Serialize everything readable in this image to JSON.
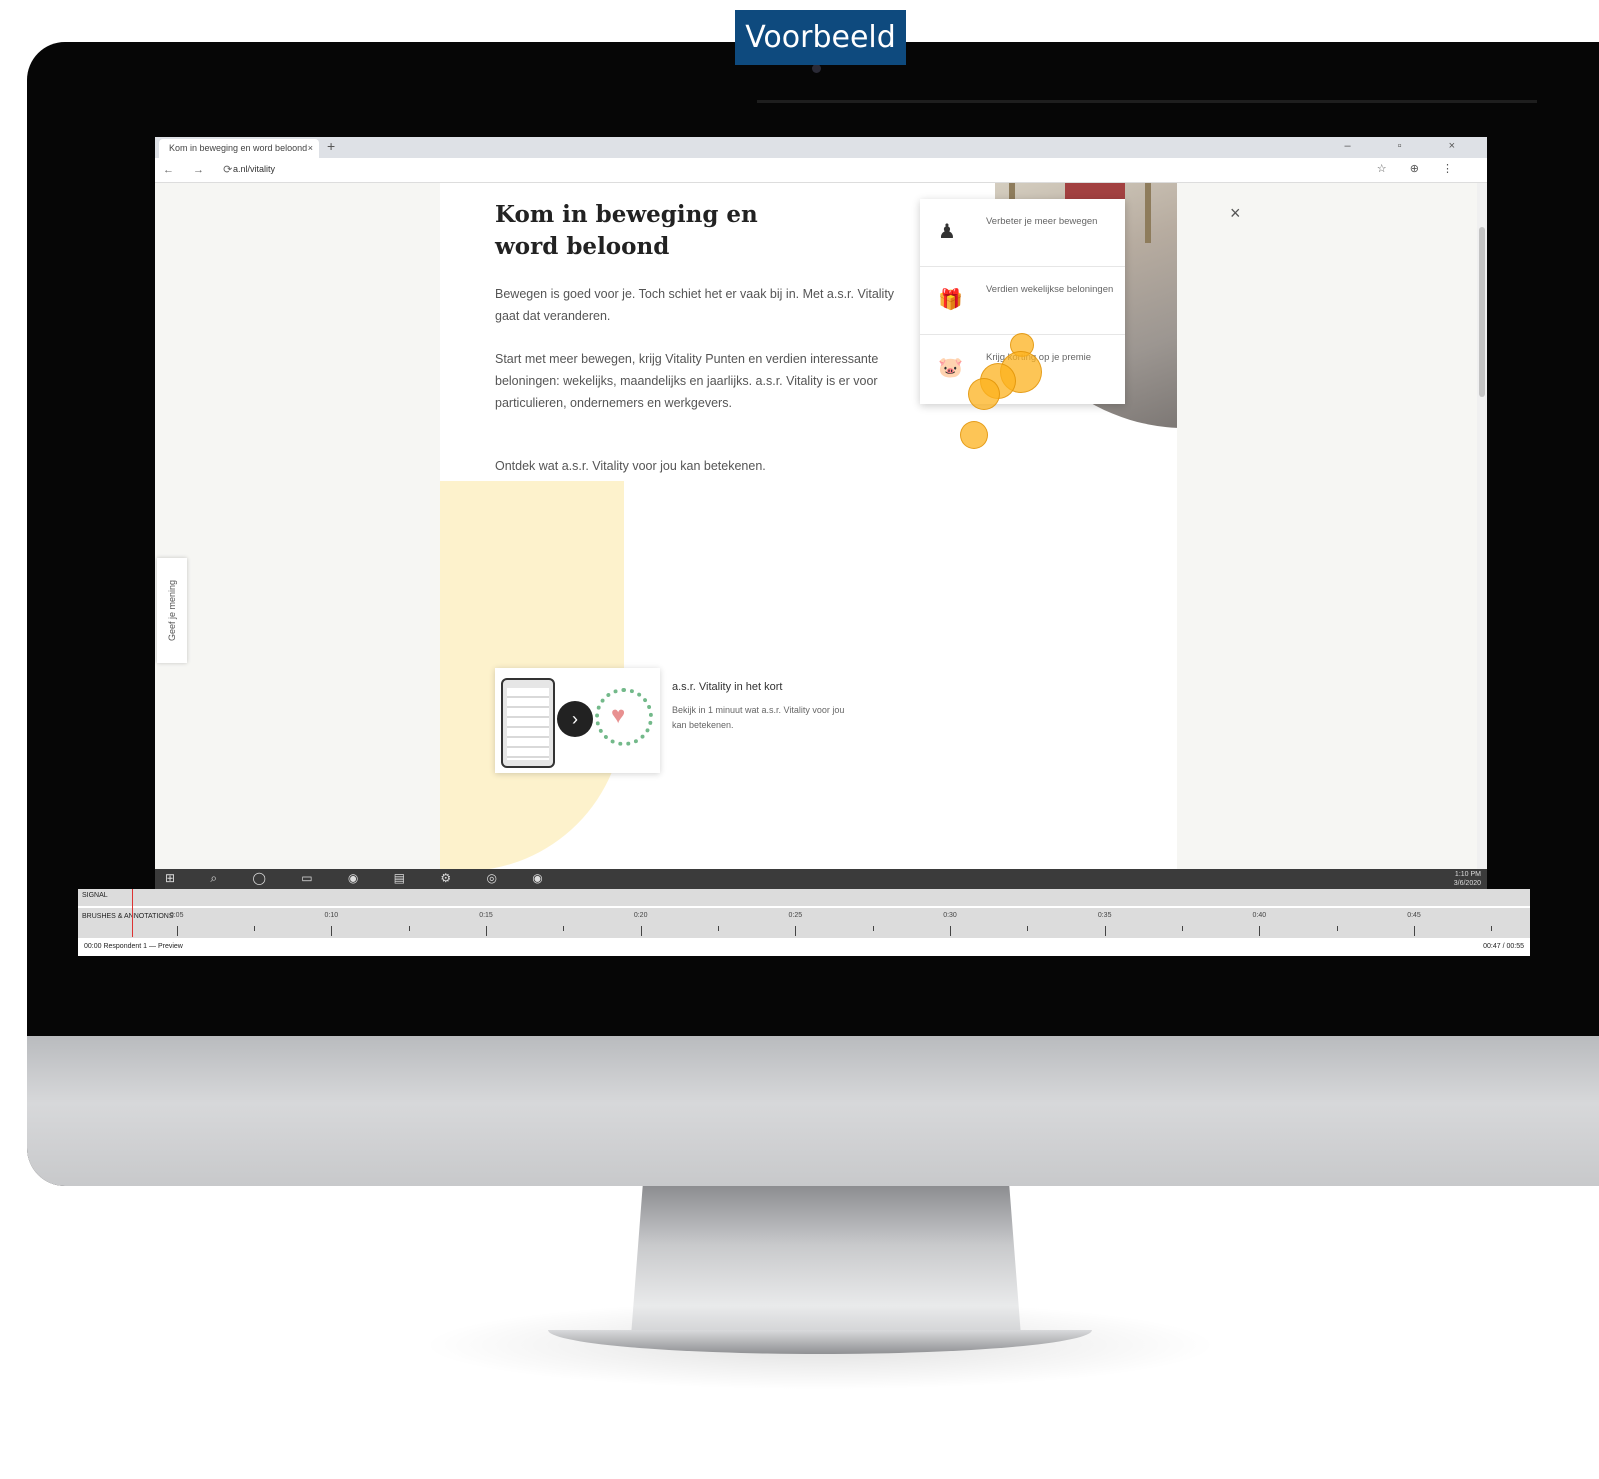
{
  "badge": {
    "label": "Voorbeeld"
  },
  "browser": {
    "tab_title": "Kom in beweging en word beloond",
    "tab_close": "×",
    "new_tab": "+",
    "window_controls": "–  ▫  ×",
    "nav_buttons": "← → ⟳",
    "url": "a.nl/vitality",
    "toolbar_icons": "☆ ⊕ ⋮"
  },
  "page": {
    "heading": "Kom in beweging en word beloond",
    "paragraph1": "Bewegen is goed voor je. Toch schiet het er vaak bij in. Met a.s.r. Vitality gaat dat veranderen.",
    "paragraph2": "Start met meer bewegen, krijg Vitality Punten en verdien interessante beloningen: wekelijks, maandelijks en jaarlijks. a.s.r. Vitality is er voor particulieren, ondernemers en werkgevers.",
    "paragraph3": "Ontdek wat a.s.r. Vitality voor jou kan betekenen.",
    "close": "×",
    "feedback_tab": "Geef je mening",
    "benefits": [
      {
        "icon": "walking-person-icon",
        "glyph": "♟",
        "text": "Verbeter je meer bewegen"
      },
      {
        "icon": "gift-icon",
        "glyph": "🎁",
        "text": "Verdien wekelijkse beloningen"
      },
      {
        "icon": "piggy-bank-icon",
        "glyph": "🐷",
        "text": "Krijg korting op je premie"
      }
    ],
    "video": {
      "title": "a.s.r. Vitality in het kort",
      "description": "Bekijk in 1 minuut wat a.s.r. Vitality voor jou kan betekenen.",
      "play": "›"
    }
  },
  "taskbar": {
    "icons": "⊞ ⌕ ◯ ▭ ◉ ▤ ⚙ ◎ ◉",
    "time": "1:10 PM",
    "date": "3/6/2020"
  },
  "recorder": {
    "track_label": "SIGNAL",
    "annotations_label": "BRUSHES & ANNOTATIONS",
    "ticks": [
      "0:05",
      "0:10",
      "0:15",
      "0:20",
      "0:25",
      "0:30",
      "0:35",
      "0:40",
      "0:45"
    ],
    "footer_left": "00:00 Respondent 1 — Preview",
    "footer_right": "00:47 / 00:55"
  },
  "colors": {
    "badge_bg": "#0e4a7e",
    "heatmap": "#fcb21e",
    "accent_yellow": "#fdf2cc"
  }
}
